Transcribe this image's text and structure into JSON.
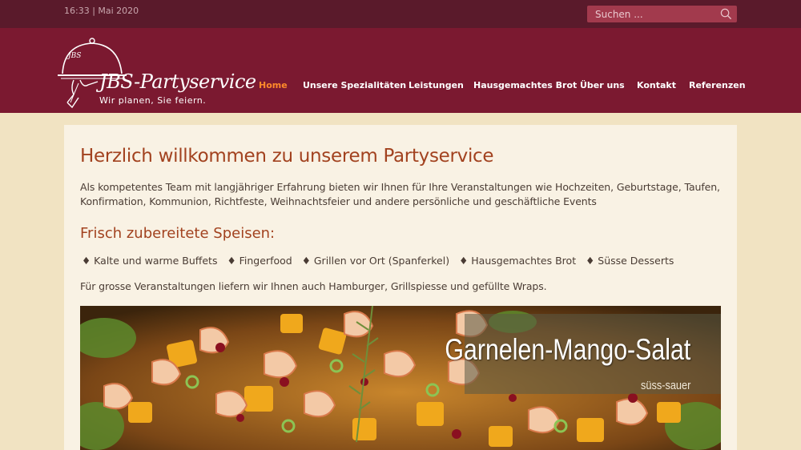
{
  "topbar": {
    "datetime": "16:33 | Mai 2020",
    "search_placeholder": "Suchen ..."
  },
  "logo": {
    "monogram": "JBS",
    "title": "JBS-Partyservice",
    "tagline": "Wir planen, Sie feiern."
  },
  "nav": {
    "items": [
      {
        "label": "Home",
        "active": true
      },
      {
        "label": "Unsere Spezialitäten"
      },
      {
        "label": "Leistungen"
      },
      {
        "label": "Hausgemachtes Brot"
      },
      {
        "label": "Über uns"
      },
      {
        "label": "Kontakt"
      },
      {
        "label": "Referenzen"
      }
    ]
  },
  "main": {
    "heading": "Herzlich willkommen zu unserem Partyservice",
    "intro": "Als kompetentes Team mit langjähriger Erfahrung bieten wir Ihnen für Ihre Veranstaltungen wie Hochzeiten, Geburtstage, Taufen, Konfirmation, Kommunion, Richtfeste, Weihnachtsfeier und andere persönliche und geschäftliche Events",
    "subheading": "Frisch zubereitete Speisen:",
    "dishes": [
      "♦ Kalte und warme Buffets",
      "♦ Fingerfood",
      "♦ Grillen vor Ort (Spanferkel)",
      "♦ Hausgemachtes Brot",
      "♦ Süsse Desserts"
    ],
    "wraps_text": "Für grosse Veranstaltungen liefern wir Ihnen auch Hamburger, Grillspiesse und gefüllte Wraps."
  },
  "slider": {
    "title": "Garnelen-Mango-Salat",
    "subtitle": "süss-sauer"
  },
  "colors": {
    "topbar": "#5a1a2b",
    "header": "#7b1930",
    "accent": "#a2421f",
    "nav_active": "#ff8a2a",
    "background": "#f1e3c2",
    "content_bg": "#f9f2e4"
  }
}
